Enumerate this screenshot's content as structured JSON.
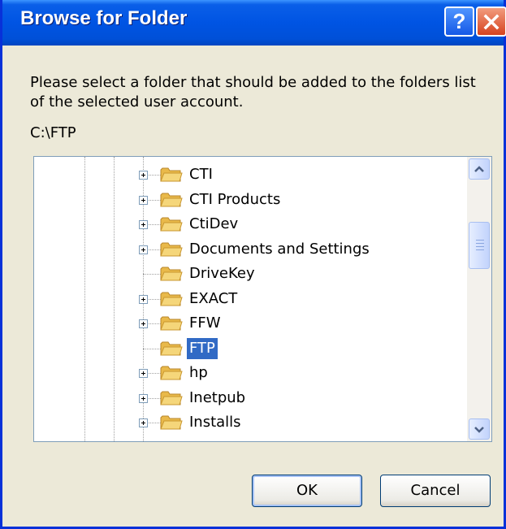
{
  "window": {
    "title": "Browse for Folder",
    "help_label": "?",
    "description": "Please select a folder that should be added to the folders list of the selected user account.",
    "selected_path": "C:\\FTP"
  },
  "tree": {
    "items": [
      {
        "label": "CTI",
        "expandable": true,
        "selected": false
      },
      {
        "label": "CTI Products",
        "expandable": true,
        "selected": false
      },
      {
        "label": "CtiDev",
        "expandable": true,
        "selected": false
      },
      {
        "label": "Documents and Settings",
        "expandable": true,
        "selected": false
      },
      {
        "label": "DriveKey",
        "expandable": false,
        "selected": false
      },
      {
        "label": "EXACT",
        "expandable": true,
        "selected": false
      },
      {
        "label": "FFW",
        "expandable": true,
        "selected": false
      },
      {
        "label": "FTP",
        "expandable": false,
        "selected": true
      },
      {
        "label": "hp",
        "expandable": true,
        "selected": false
      },
      {
        "label": "Inetpub",
        "expandable": true,
        "selected": false
      },
      {
        "label": "Installs",
        "expandable": true,
        "selected": false
      }
    ]
  },
  "buttons": {
    "ok_label": "OK",
    "cancel_label": "Cancel"
  },
  "colors": {
    "titlebar": "#0054e3",
    "selection": "#316ac5",
    "dialog_bg": "#ece9d8",
    "folder": "#f5d67a"
  },
  "icons": {
    "help": "question-mark-icon",
    "close": "close-icon",
    "folder": "folder-icon",
    "expander": "plus-box-icon",
    "scroll_up": "chevron-up-icon",
    "scroll_down": "chevron-down-icon"
  }
}
